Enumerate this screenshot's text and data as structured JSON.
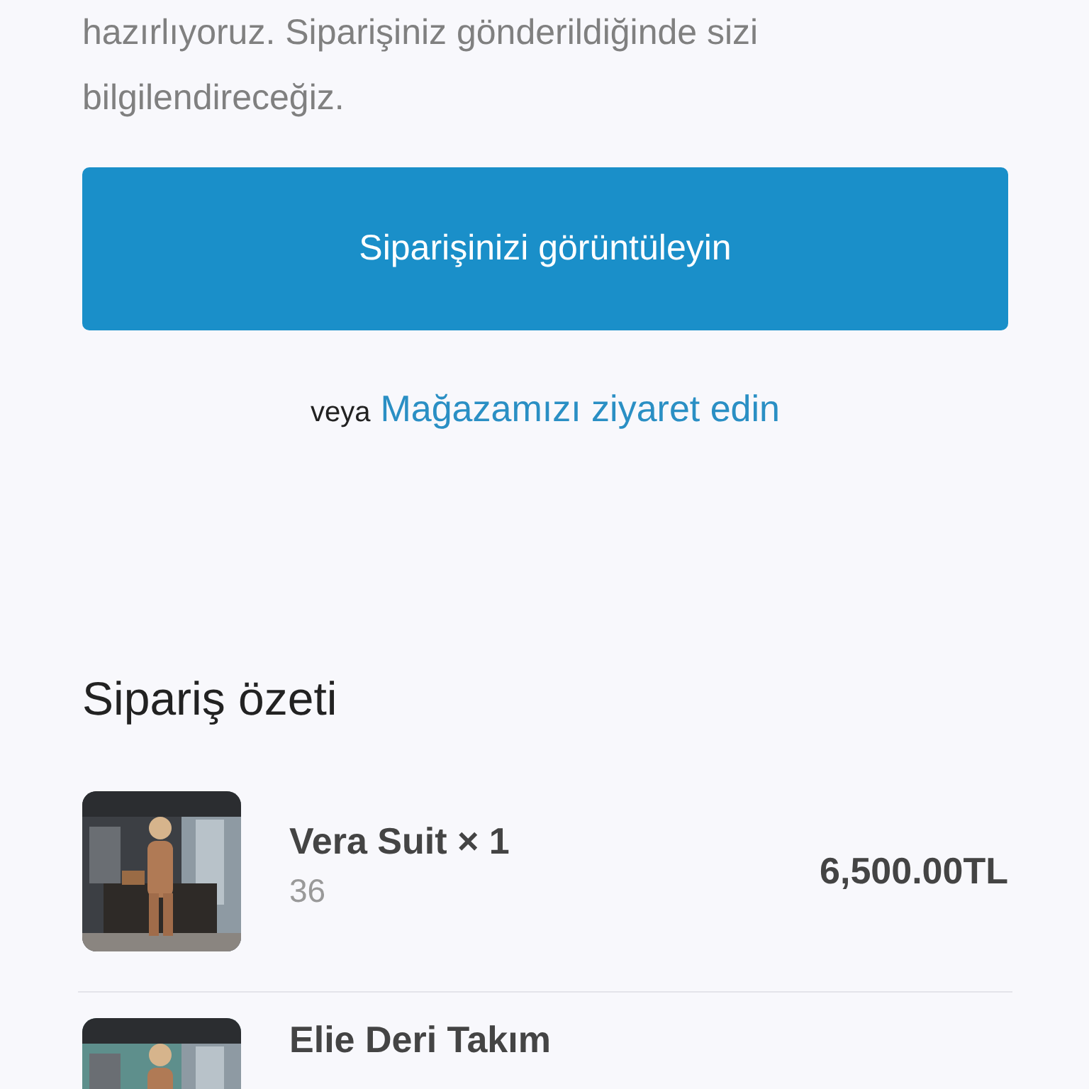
{
  "message": "hazırlıyoruz. Siparişiniz gönderildiğinde sizi bilgilendireceğiz.",
  "primary_button": "Siparişinizi görüntüleyin",
  "alternative": {
    "prefix": "veya",
    "link": "Mağazamızı ziyaret edin"
  },
  "summary": {
    "title": "Sipariş özeti",
    "items": [
      {
        "name": "Vera Suit × 1",
        "variant": "36",
        "price": "6,500.00TL",
        "kind": "picture"
      },
      {
        "name": "Elie Deri Takım",
        "kind": "picture"
      }
    ]
  }
}
